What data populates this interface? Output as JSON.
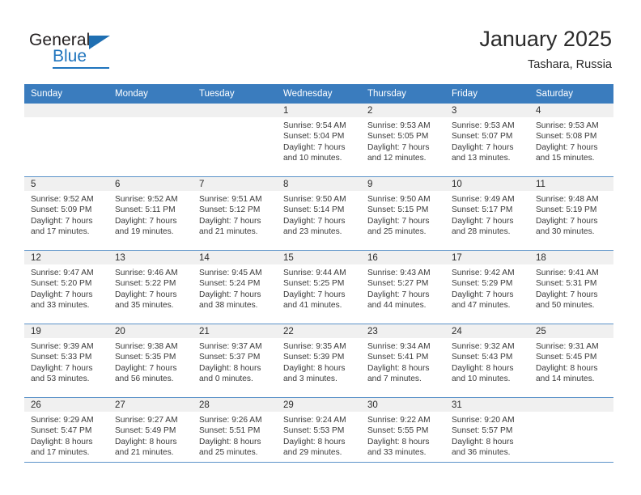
{
  "brand": {
    "name_top": "General",
    "name_bottom": "Blue",
    "triangle_color": "#1f6fb2",
    "blue_color": "#1f74bd"
  },
  "header": {
    "title": "January 2025",
    "subtitle": "Tashara, Russia"
  },
  "theme": {
    "header_row_bg": "#3a7cbe",
    "header_row_text": "#ffffff",
    "daynum_bar_bg": "#f0f0f0",
    "grid_line": "#5b92c9"
  },
  "calendar": {
    "weekday_headers": [
      "Sunday",
      "Monday",
      "Tuesday",
      "Wednesday",
      "Thursday",
      "Friday",
      "Saturday"
    ],
    "weeks": [
      [
        {
          "day": "",
          "empty": true,
          "sunrise": "",
          "sunset": "",
          "daylight_line1": "",
          "daylight_line2": ""
        },
        {
          "day": "",
          "empty": true,
          "sunrise": "",
          "sunset": "",
          "daylight_line1": "",
          "daylight_line2": ""
        },
        {
          "day": "",
          "empty": true,
          "sunrise": "",
          "sunset": "",
          "daylight_line1": "",
          "daylight_line2": ""
        },
        {
          "day": "1",
          "empty": false,
          "sunrise": "Sunrise: 9:54 AM",
          "sunset": "Sunset: 5:04 PM",
          "daylight_line1": "Daylight: 7 hours",
          "daylight_line2": "and 10 minutes."
        },
        {
          "day": "2",
          "empty": false,
          "sunrise": "Sunrise: 9:53 AM",
          "sunset": "Sunset: 5:05 PM",
          "daylight_line1": "Daylight: 7 hours",
          "daylight_line2": "and 12 minutes."
        },
        {
          "day": "3",
          "empty": false,
          "sunrise": "Sunrise: 9:53 AM",
          "sunset": "Sunset: 5:07 PM",
          "daylight_line1": "Daylight: 7 hours",
          "daylight_line2": "and 13 minutes."
        },
        {
          "day": "4",
          "empty": false,
          "sunrise": "Sunrise: 9:53 AM",
          "sunset": "Sunset: 5:08 PM",
          "daylight_line1": "Daylight: 7 hours",
          "daylight_line2": "and 15 minutes."
        }
      ],
      [
        {
          "day": "5",
          "empty": false,
          "sunrise": "Sunrise: 9:52 AM",
          "sunset": "Sunset: 5:09 PM",
          "daylight_line1": "Daylight: 7 hours",
          "daylight_line2": "and 17 minutes."
        },
        {
          "day": "6",
          "empty": false,
          "sunrise": "Sunrise: 9:52 AM",
          "sunset": "Sunset: 5:11 PM",
          "daylight_line1": "Daylight: 7 hours",
          "daylight_line2": "and 19 minutes."
        },
        {
          "day": "7",
          "empty": false,
          "sunrise": "Sunrise: 9:51 AM",
          "sunset": "Sunset: 5:12 PM",
          "daylight_line1": "Daylight: 7 hours",
          "daylight_line2": "and 21 minutes."
        },
        {
          "day": "8",
          "empty": false,
          "sunrise": "Sunrise: 9:50 AM",
          "sunset": "Sunset: 5:14 PM",
          "daylight_line1": "Daylight: 7 hours",
          "daylight_line2": "and 23 minutes."
        },
        {
          "day": "9",
          "empty": false,
          "sunrise": "Sunrise: 9:50 AM",
          "sunset": "Sunset: 5:15 PM",
          "daylight_line1": "Daylight: 7 hours",
          "daylight_line2": "and 25 minutes."
        },
        {
          "day": "10",
          "empty": false,
          "sunrise": "Sunrise: 9:49 AM",
          "sunset": "Sunset: 5:17 PM",
          "daylight_line1": "Daylight: 7 hours",
          "daylight_line2": "and 28 minutes."
        },
        {
          "day": "11",
          "empty": false,
          "sunrise": "Sunrise: 9:48 AM",
          "sunset": "Sunset: 5:19 PM",
          "daylight_line1": "Daylight: 7 hours",
          "daylight_line2": "and 30 minutes."
        }
      ],
      [
        {
          "day": "12",
          "empty": false,
          "sunrise": "Sunrise: 9:47 AM",
          "sunset": "Sunset: 5:20 PM",
          "daylight_line1": "Daylight: 7 hours",
          "daylight_line2": "and 33 minutes."
        },
        {
          "day": "13",
          "empty": false,
          "sunrise": "Sunrise: 9:46 AM",
          "sunset": "Sunset: 5:22 PM",
          "daylight_line1": "Daylight: 7 hours",
          "daylight_line2": "and 35 minutes."
        },
        {
          "day": "14",
          "empty": false,
          "sunrise": "Sunrise: 9:45 AM",
          "sunset": "Sunset: 5:24 PM",
          "daylight_line1": "Daylight: 7 hours",
          "daylight_line2": "and 38 minutes."
        },
        {
          "day": "15",
          "empty": false,
          "sunrise": "Sunrise: 9:44 AM",
          "sunset": "Sunset: 5:25 PM",
          "daylight_line1": "Daylight: 7 hours",
          "daylight_line2": "and 41 minutes."
        },
        {
          "day": "16",
          "empty": false,
          "sunrise": "Sunrise: 9:43 AM",
          "sunset": "Sunset: 5:27 PM",
          "daylight_line1": "Daylight: 7 hours",
          "daylight_line2": "and 44 minutes."
        },
        {
          "day": "17",
          "empty": false,
          "sunrise": "Sunrise: 9:42 AM",
          "sunset": "Sunset: 5:29 PM",
          "daylight_line1": "Daylight: 7 hours",
          "daylight_line2": "and 47 minutes."
        },
        {
          "day": "18",
          "empty": false,
          "sunrise": "Sunrise: 9:41 AM",
          "sunset": "Sunset: 5:31 PM",
          "daylight_line1": "Daylight: 7 hours",
          "daylight_line2": "and 50 minutes."
        }
      ],
      [
        {
          "day": "19",
          "empty": false,
          "sunrise": "Sunrise: 9:39 AM",
          "sunset": "Sunset: 5:33 PM",
          "daylight_line1": "Daylight: 7 hours",
          "daylight_line2": "and 53 minutes."
        },
        {
          "day": "20",
          "empty": false,
          "sunrise": "Sunrise: 9:38 AM",
          "sunset": "Sunset: 5:35 PM",
          "daylight_line1": "Daylight: 7 hours",
          "daylight_line2": "and 56 minutes."
        },
        {
          "day": "21",
          "empty": false,
          "sunrise": "Sunrise: 9:37 AM",
          "sunset": "Sunset: 5:37 PM",
          "daylight_line1": "Daylight: 8 hours",
          "daylight_line2": "and 0 minutes."
        },
        {
          "day": "22",
          "empty": false,
          "sunrise": "Sunrise: 9:35 AM",
          "sunset": "Sunset: 5:39 PM",
          "daylight_line1": "Daylight: 8 hours",
          "daylight_line2": "and 3 minutes."
        },
        {
          "day": "23",
          "empty": false,
          "sunrise": "Sunrise: 9:34 AM",
          "sunset": "Sunset: 5:41 PM",
          "daylight_line1": "Daylight: 8 hours",
          "daylight_line2": "and 7 minutes."
        },
        {
          "day": "24",
          "empty": false,
          "sunrise": "Sunrise: 9:32 AM",
          "sunset": "Sunset: 5:43 PM",
          "daylight_line1": "Daylight: 8 hours",
          "daylight_line2": "and 10 minutes."
        },
        {
          "day": "25",
          "empty": false,
          "sunrise": "Sunrise: 9:31 AM",
          "sunset": "Sunset: 5:45 PM",
          "daylight_line1": "Daylight: 8 hours",
          "daylight_line2": "and 14 minutes."
        }
      ],
      [
        {
          "day": "26",
          "empty": false,
          "sunrise": "Sunrise: 9:29 AM",
          "sunset": "Sunset: 5:47 PM",
          "daylight_line1": "Daylight: 8 hours",
          "daylight_line2": "and 17 minutes."
        },
        {
          "day": "27",
          "empty": false,
          "sunrise": "Sunrise: 9:27 AM",
          "sunset": "Sunset: 5:49 PM",
          "daylight_line1": "Daylight: 8 hours",
          "daylight_line2": "and 21 minutes."
        },
        {
          "day": "28",
          "empty": false,
          "sunrise": "Sunrise: 9:26 AM",
          "sunset": "Sunset: 5:51 PM",
          "daylight_line1": "Daylight: 8 hours",
          "daylight_line2": "and 25 minutes."
        },
        {
          "day": "29",
          "empty": false,
          "sunrise": "Sunrise: 9:24 AM",
          "sunset": "Sunset: 5:53 PM",
          "daylight_line1": "Daylight: 8 hours",
          "daylight_line2": "and 29 minutes."
        },
        {
          "day": "30",
          "empty": false,
          "sunrise": "Sunrise: 9:22 AM",
          "sunset": "Sunset: 5:55 PM",
          "daylight_line1": "Daylight: 8 hours",
          "daylight_line2": "and 33 minutes."
        },
        {
          "day": "31",
          "empty": false,
          "sunrise": "Sunrise: 9:20 AM",
          "sunset": "Sunset: 5:57 PM",
          "daylight_line1": "Daylight: 8 hours",
          "daylight_line2": "and 36 minutes."
        },
        {
          "day": "",
          "empty": true,
          "sunrise": "",
          "sunset": "",
          "daylight_line1": "",
          "daylight_line2": ""
        }
      ]
    ]
  }
}
